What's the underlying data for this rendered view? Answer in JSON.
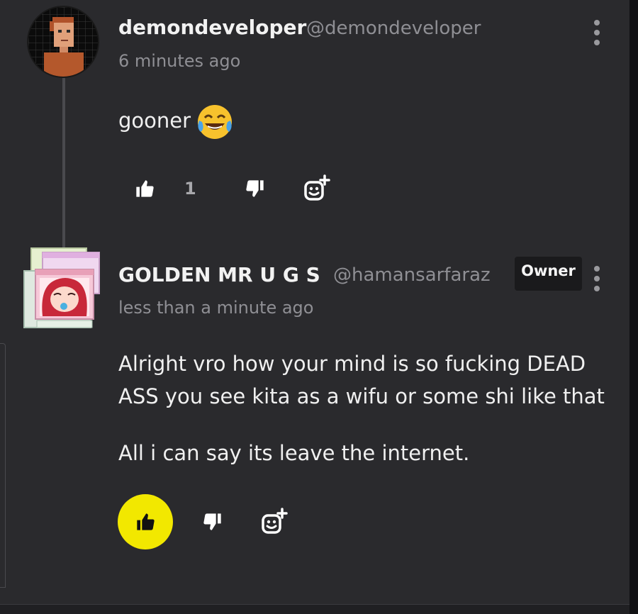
{
  "comments": [
    {
      "author": "demondeveloper",
      "handle": "@demondeveloper",
      "time": "6 minutes ago",
      "body": "gooner",
      "body_emoji": "face-with-tears-of-joy",
      "like_count": "1",
      "liked": false
    },
    {
      "author": "GOLDEN MR U G S",
      "handle": "@hamansarfaraz",
      "badge": "Owner",
      "time": "less than a minute ago",
      "body_lines": [
        "Alright vro how your mind is so fucking DEAD",
        "ASS you see kita as a wifu or some shi like that",
        "All i can say its leave the internet."
      ],
      "liked": true
    }
  ],
  "icons": {
    "like": "thumbs-up-icon",
    "dislike": "thumbs-down-icon",
    "react": "add-reaction-icon",
    "menu": "more-vertical-icon"
  },
  "colors": {
    "background": "#2a2a2d",
    "liked_highlight": "#f2e800",
    "text_primary": "#f0f0f0",
    "text_secondary": "#8f8f94"
  }
}
